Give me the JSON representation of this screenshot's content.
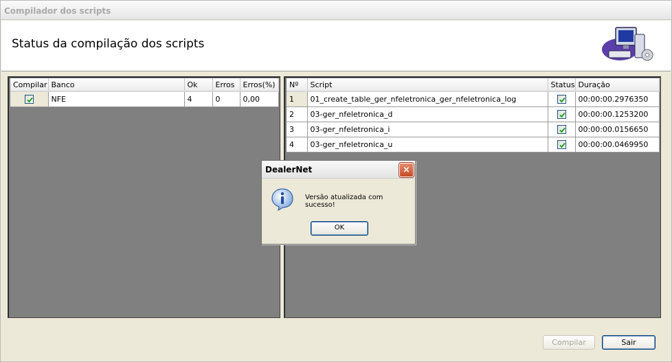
{
  "window": {
    "title": "Compilador dos scripts"
  },
  "header": {
    "heading": "Status da compilação dos scripts",
    "logo_icon": "computer-icon"
  },
  "banco_table": {
    "columns": [
      "Compilar",
      "Banco",
      "Ok",
      "Erros",
      "Erros(%)"
    ],
    "rows": [
      {
        "compilar": true,
        "banco": "NFE",
        "ok": "4",
        "erros": "0",
        "erros_pct": "0,00"
      }
    ]
  },
  "script_table": {
    "columns": [
      "Nº",
      "Script",
      "Status",
      "Duração"
    ],
    "rows": [
      {
        "num": "1",
        "script": "01_create_table_ger_nfeletronica_ger_nfeletronica_log",
        "status": true,
        "duracao": "00:00:00.2976350"
      },
      {
        "num": "2",
        "script": "03-ger_nfeletronica_d",
        "status": true,
        "duracao": "00:00:00.1253200"
      },
      {
        "num": "3",
        "script": "03-ger_nfeletronica_i",
        "status": true,
        "duracao": "00:00:00.0156650"
      },
      {
        "num": "4",
        "script": "03-ger_nfeletronica_u",
        "status": true,
        "duracao": "00:00:00.0469950"
      }
    ]
  },
  "dialog": {
    "title": "DealerNet",
    "close": "×",
    "message": "Versão atualizada com sucesso!",
    "ok_label": "OK",
    "icon": "info-icon"
  },
  "footer": {
    "compilar_label": "Compilar",
    "compilar_enabled": false,
    "sair_label": "Sair"
  },
  "colors": {
    "check_green": "#21a121",
    "panel_gray": "#808080",
    "window_bg": "#ece9d8",
    "close_red": "#c44a26"
  }
}
